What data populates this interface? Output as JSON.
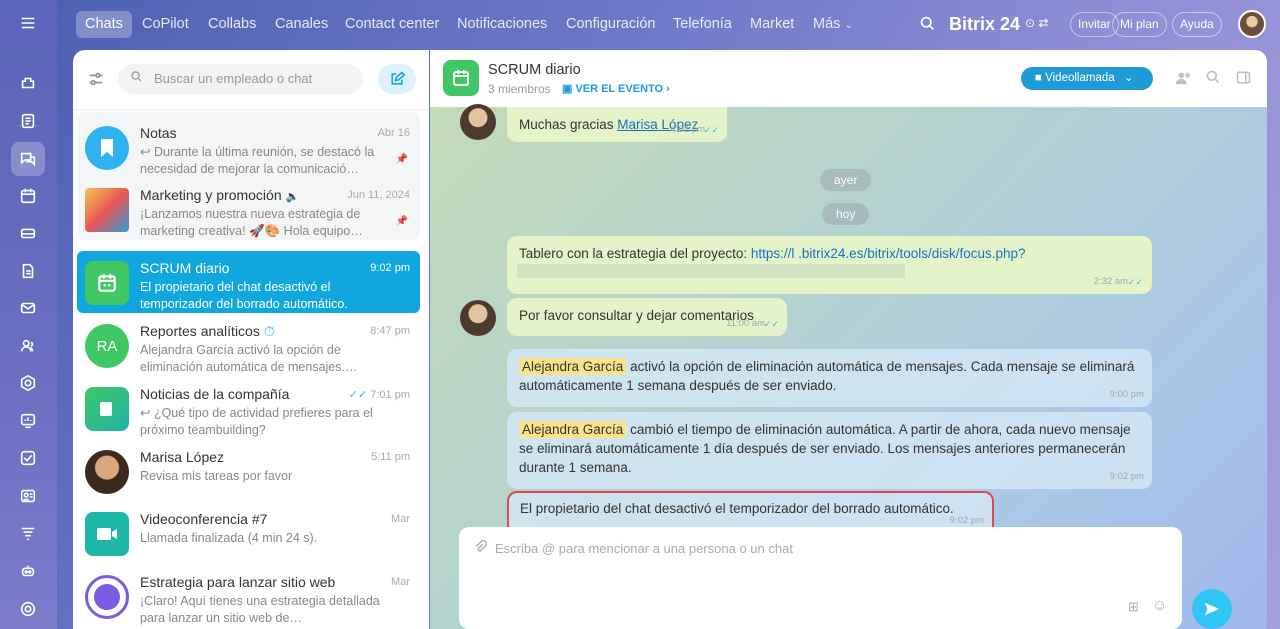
{
  "nav": {
    "items": [
      "Chats",
      "CoPilot",
      "Collabs",
      "Canales",
      "Contact center",
      "Notificaciones",
      "Configuración",
      "Telefonía",
      "Market",
      "Más"
    ],
    "brand": "Bitrix 24",
    "invite": "Invitar",
    "myplan": "Mi plan",
    "help": "Ayuda"
  },
  "sidebar": {
    "search_placeholder": "Buscar un empleado o chat",
    "chats": [
      {
        "name": "Notas",
        "time": "Abr 16",
        "preview": "↩ Durante la última reunión, se destacó la necesidad de mejorar la comunicació…"
      },
      {
        "name": "Marketing y promoción",
        "time": "Jun 11, 2024",
        "preview": "¡Lanzamos nuestra nueva estrategia de marketing creativa! 🚀🎨 Hola equipo…"
      },
      {
        "name": "SCRUM diario",
        "time": "9:02 pm",
        "preview": "El propietario del chat desactivó el temporizador del borrado automático."
      },
      {
        "name": "Reportes analíticos",
        "time": "8:47 pm",
        "preview": "Alejandra García activó la opción de eliminación automática de mensajes.…",
        "initials": "RA"
      },
      {
        "name": "Noticias de la compañía",
        "time": "7:01 pm",
        "preview": "↩ ¿Qué tipo de actividad prefieres para el próximo teambuilding?"
      },
      {
        "name": "Marisa López",
        "time": "5:11 pm",
        "preview": "Revisa mis tareas por favor"
      },
      {
        "name": "Videoconferencia #7",
        "time": "Mar",
        "preview": "Llamada finalizada (4 min 24 s)."
      },
      {
        "name": "Estrategia para lanzar sitio web",
        "time": "Mar",
        "preview": "¡Claro! Aquí tienes una estrategia detallada para lanzar un sitio web de…"
      }
    ]
  },
  "chat": {
    "title": "SCRUM diario",
    "members": "3 miembros",
    "event": "VER EL EVENTO",
    "videocall": "Videollamada",
    "messages": {
      "m1_text": "Muchas gracias ",
      "m1_mention": "Marisa López",
      "m1_time": "4:02 pm",
      "day1": "ayer",
      "day2": "hoy",
      "m2_text": "Tablero con la estrategia del proyecto: ",
      "m2_link": "https://l          .bitrix24.es/bitrix/tools/disk/focus.php?",
      "m2_time": "2:32 am",
      "m3_text": "Por favor consultar y dejar comentarios",
      "m3_time": "11:00 am",
      "m4_name": "Alejandra García",
      "m4_text": " activó la opción de eliminación automática de mensajes. Cada mensaje se eliminará automáticamente 1 semana después de ser enviado.",
      "m4_time": "9:00 pm",
      "m5_name": "Alejandra García",
      "m5_text": " cambió el tiempo de eliminación automática. A partir de ahora, cada nuevo mensaje se eliminará automáticamente 1 día después de ser enviado. Los mensajes anteriores permanecerán durante 1 semana.",
      "m5_time": "9:02 pm",
      "m6_text": "El propietario del chat desactivó el temporizador del borrado automático.",
      "m6_time": "9:02 pm"
    },
    "input_placeholder": "Escriba @ para mencionar a una persona o un chat"
  }
}
